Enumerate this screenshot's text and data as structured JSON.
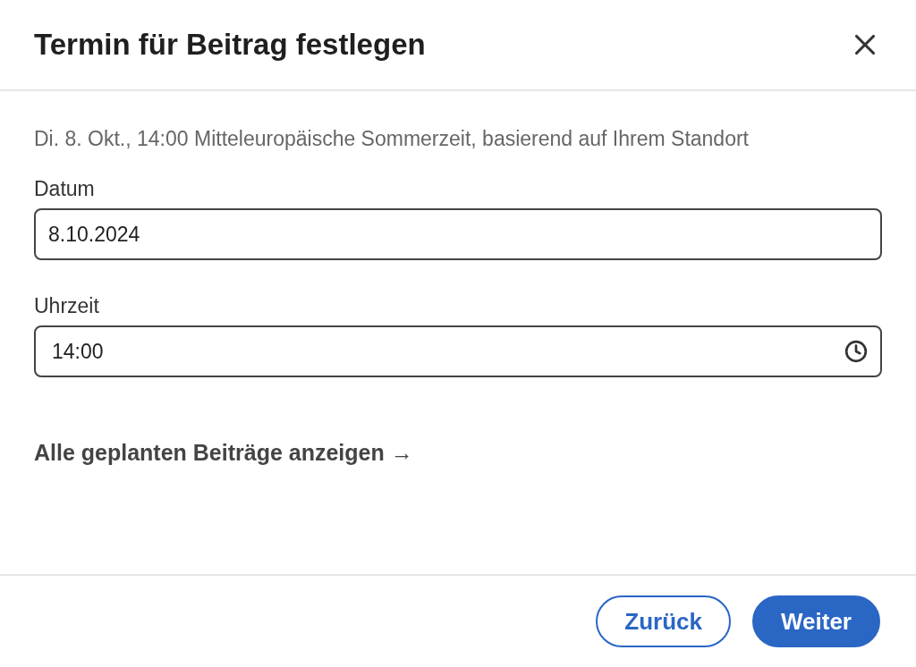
{
  "dialog": {
    "title": "Termin für Beitrag festlegen"
  },
  "info": "Di. 8. Okt., 14:00 Mitteleuropäische Sommerzeit, basierend auf Ihrem Standort",
  "fields": [
    {
      "kind": "date",
      "label": "Datum",
      "value": "8.10.2024"
    },
    {
      "kind": "time",
      "label": "Uhrzeit",
      "value": "14:00"
    }
  ],
  "link": "Alle geplanten Beiträge anzeigen →",
  "buttons": [
    {
      "kind": "secondary",
      "label": "Zurück"
    },
    {
      "kind": "primary",
      "label": "Weiter"
    }
  ]
}
